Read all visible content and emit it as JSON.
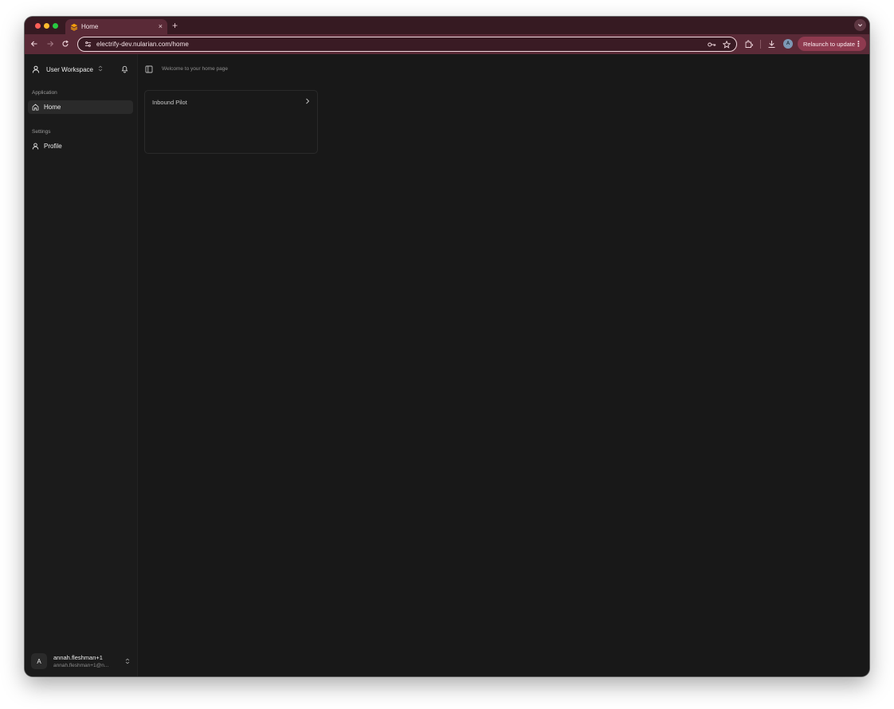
{
  "browser": {
    "tab": {
      "title": "Home",
      "close_label": "×"
    },
    "new_tab_label": "+",
    "url": "electrify-dev.nularian.com/home",
    "profile_initial": "A",
    "relaunch_label": "Relaunch to update",
    "relaunch_menu": "⋮"
  },
  "sidebar": {
    "workspace_label": "User Workspace",
    "workspace_chevrons": "⌃⌄",
    "groups": [
      {
        "label": "Application",
        "items": [
          {
            "label": "Home",
            "icon": "home-icon",
            "active": true
          }
        ]
      },
      {
        "label": "Settings",
        "items": [
          {
            "label": "Profile",
            "icon": "user-icon",
            "active": false
          }
        ]
      }
    ],
    "user": {
      "initial": "A",
      "name": "annah.fleshman+1",
      "email": "annah.fleshman+1@n..."
    }
  },
  "main": {
    "welcome_text": "Welcome to your home page",
    "cards": [
      {
        "title": "Inbound Pilot"
      }
    ]
  },
  "colors": {
    "tabstrip": "#361a22",
    "toolbar": "#5a2a37",
    "relaunch": "#8e3a4f",
    "app_bg": "#181818",
    "sidebar_bg": "#1b1b1b"
  }
}
